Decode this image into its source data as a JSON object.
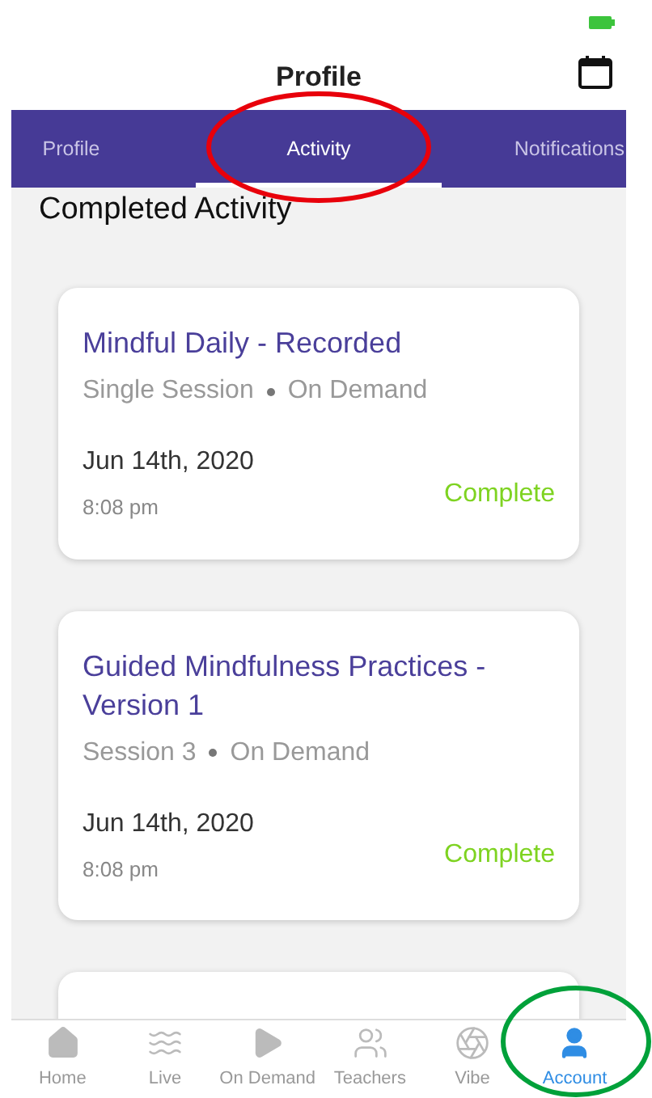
{
  "header": {
    "title": "Profile"
  },
  "tabs": [
    {
      "label": "Profile",
      "selected": false
    },
    {
      "label": "Activity",
      "selected": true
    },
    {
      "label": "Notifications",
      "selected": false
    }
  ],
  "section_title": "Completed Activity",
  "activities": [
    {
      "title": "Mindful Daily - Recorded",
      "type": "Single Session",
      "source": "On Demand",
      "date": "Jun 14th, 2020",
      "time": "8:08 pm",
      "status": "Complete"
    },
    {
      "title": "Guided Mindfulness Practices - Version 1",
      "type": "Session 3",
      "source": "On Demand",
      "date": "Jun 14th, 2020",
      "time": "8:08 pm",
      "status": "Complete"
    }
  ],
  "nav": [
    {
      "label": "Home",
      "kind": "home",
      "selected": false
    },
    {
      "label": "Live",
      "kind": "live",
      "selected": false
    },
    {
      "label": "On Demand",
      "kind": "ondemand",
      "selected": false
    },
    {
      "label": "Teachers",
      "kind": "teachers",
      "selected": false
    },
    {
      "label": "Vibe",
      "kind": "vibe",
      "selected": false
    },
    {
      "label": "Account",
      "kind": "account",
      "selected": true
    }
  ],
  "annotations": [
    {
      "kind": "ellipse",
      "color": "#e8000b"
    },
    {
      "kind": "ellipse",
      "color": "#00a13a"
    }
  ]
}
